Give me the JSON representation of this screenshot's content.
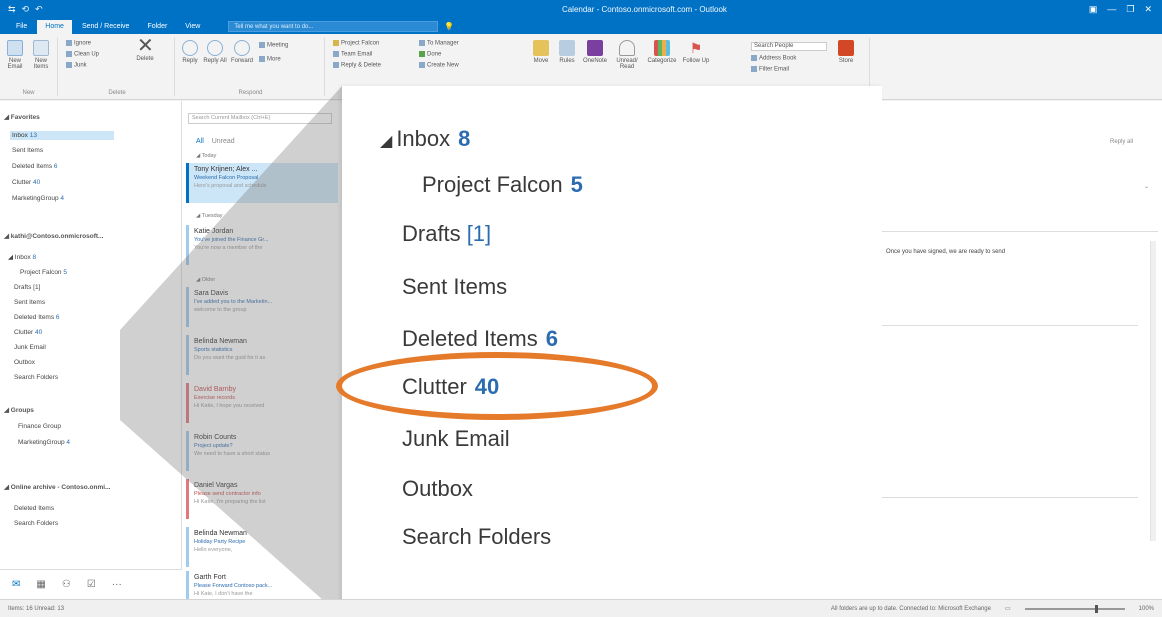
{
  "window": {
    "title": "Calendar - Contoso.onmicrosoft.com - Outlook",
    "qat": [
      "⇆",
      "⟲",
      "↶"
    ],
    "controls": [
      "▣",
      "—",
      "❐",
      "✕"
    ]
  },
  "tabs": [
    "File",
    "Home",
    "Send / Receive",
    "Folder",
    "View"
  ],
  "tell_me_placeholder": "Tell me what you want to do...",
  "ribbon": {
    "new_email": "New Email",
    "new_items": "New Items",
    "ignore": "Ignore",
    "clean_up": "Clean Up",
    "junk": "Junk",
    "delete": "Delete",
    "reply": "Reply",
    "reply_all": "Reply All",
    "forward": "Forward",
    "meeting": "Meeting",
    "more": "More",
    "project_falcon": "Project Falcon",
    "team_email": "Team Email",
    "reply_delete": "Reply & Delete",
    "to_manager": "To Manager",
    "done": "Done",
    "create_new": "Create New",
    "move": "Move",
    "rules": "Rules",
    "onenote": "OneNote",
    "unread": "Unread/ Read",
    "categorize": "Categorize",
    "follow_up": "Follow Up",
    "search_people": "Search People",
    "address_book": "Address Book",
    "filter_email": "Filter Email",
    "store": "Store",
    "group_new": "New",
    "group_delete": "Delete",
    "group_respond": "Respond"
  },
  "folder_pane": {
    "favorites": "◢ Favorites",
    "fav_inbox": "Inbox",
    "fav_inbox_count": "13",
    "fav_sent": "Sent Items",
    "fav_deleted": "Deleted Items",
    "fav_deleted_count": "6",
    "fav_clutter": "Clutter",
    "fav_clutter_count": "40",
    "fav_marketing": "MarketingGroup",
    "fav_marketing_count": "4",
    "account": "◢ kathi@Contoso.onmicrosoft...",
    "acc_inbox": "◢ Inbox",
    "acc_inbox_count": "8",
    "acc_project": "Project Falcon",
    "acc_project_count": "5",
    "acc_drafts": "Drafts [1]",
    "acc_sent": "Sent Items",
    "acc_deleted": "Deleted Items",
    "acc_deleted_count": "6",
    "acc_clutter": "Clutter",
    "acc_clutter_count": "40",
    "acc_junk": "Junk Email",
    "acc_outbox": "Outbox",
    "acc_search": "Search Folders",
    "groups": "◢ Groups",
    "grp_finance": "Finance Group",
    "grp_marketing": "MarketingGroup",
    "grp_marketing_count": "4",
    "archive": "◢ Online archive - Contoso.onmi...",
    "arc_deleted": "Deleted Items",
    "arc_search": "Search Folders",
    "nav": [
      "✉",
      "▦",
      "⚇",
      "☑",
      "···"
    ]
  },
  "message_list": {
    "search_placeholder": "Search Current Mailbox (Ctrl+E)",
    "filter_all": "All",
    "filter_unread": "Unread",
    "groups": [
      "◢ Today",
      "◢ Tuesday",
      "◢ Older"
    ],
    "messages": [
      {
        "from": "Tony Krijnen; Alex ...",
        "subject": "Weekend Falcon Proposal",
        "preview": "Here's proposal and schedule"
      },
      {
        "from": "Katie Jordan",
        "subject": "You've joined the Finance Gr...",
        "preview": "You're now a member of the"
      },
      {
        "from": "Sara Davis",
        "subject": "I've added you to the Marketin...",
        "preview": "welcome to the group"
      },
      {
        "from": "Belinda Newman",
        "subject": "Sports statistics",
        "preview": "Do you want the guid for it as"
      },
      {
        "from": "David Barnby",
        "subject": "Exercise records",
        "preview": "Hi Katie, I hope you received"
      },
      {
        "from": "Robin Counts",
        "subject": "Project update?",
        "preview": "We need to have a short status"
      },
      {
        "from": "Daniel Vargas",
        "subject": "Please send contractor info",
        "preview": "Hi Katie, I'm preparing the list"
      },
      {
        "from": "Belinda Newman",
        "subject": "Holiday Party Recipe",
        "preview": "Hello everyone,"
      },
      {
        "from": "Garth Fort",
        "subject": "Please Forward Contoso pack...",
        "preview": "Hi Kate, I don't have the"
      }
    ]
  },
  "zoom": {
    "inbox": "Inbox",
    "inbox_count": "8",
    "project_falcon": "Project Falcon",
    "project_count": "5",
    "drafts": "Drafts",
    "drafts_count": "[1]",
    "sent": "Sent Items",
    "deleted": "Deleted Items",
    "deleted_count": "6",
    "clutter": "Clutter",
    "clutter_count": "40",
    "junk": "Junk Email",
    "outbox": "Outbox",
    "search": "Search Folders"
  },
  "reading": {
    "body_line": "Once you have signed, we are ready to send",
    "reply_label": "Reply all"
  },
  "status": {
    "left": "Items: 16   Unread: 13",
    "right": "All folders are up to date.   Connected to: Microsoft Exchange",
    "zoom": "100%"
  },
  "colors": {
    "accent": "#0072c6",
    "highlight": "#e57a2b",
    "count": "#2b6cb0"
  }
}
